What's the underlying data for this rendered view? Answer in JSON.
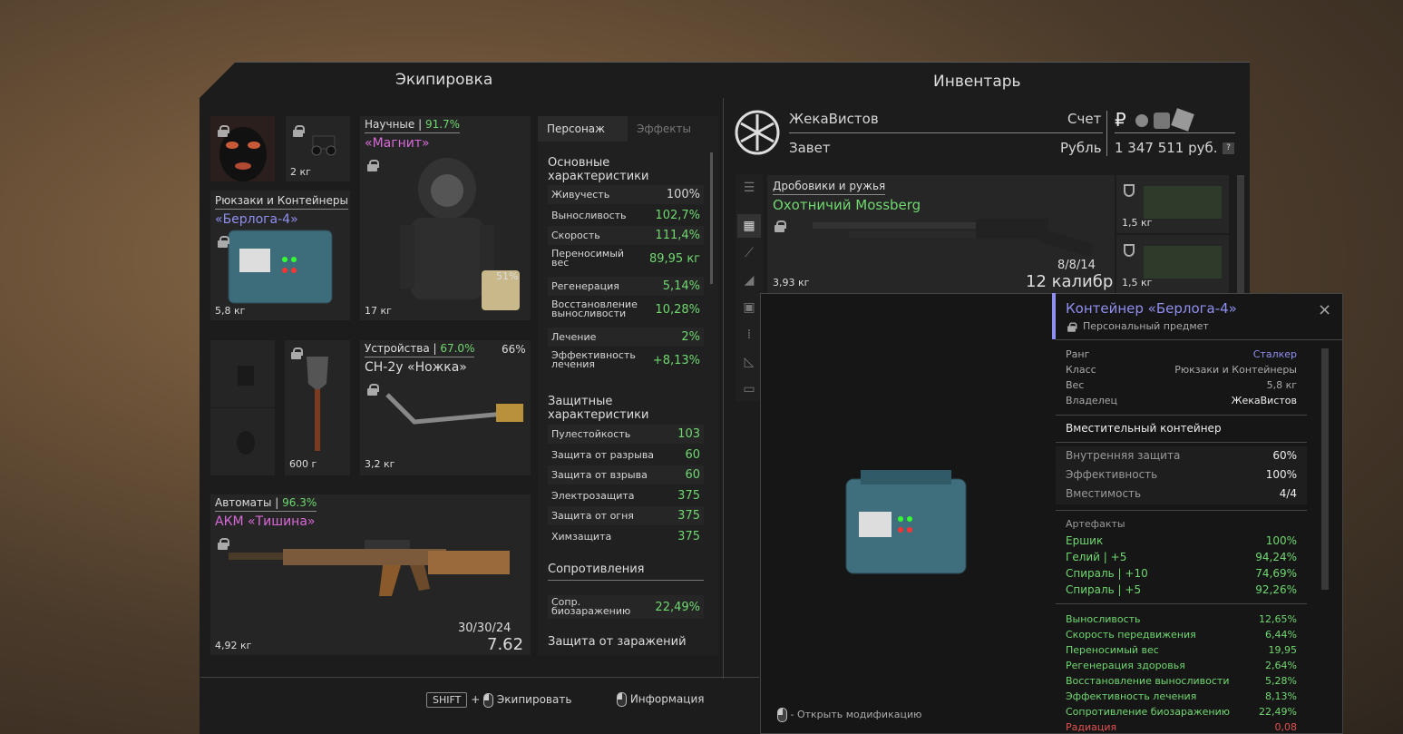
{
  "equipment": {
    "title": "Экипировка",
    "mask": {
      "icon": "mask-icon"
    },
    "nvg": {
      "weight": "2 кг"
    },
    "backpack": {
      "category": "Рюкзаки и Контейнеры",
      "name": "«Берлога-4»",
      "weight": "5,8 кг"
    },
    "armor": {
      "category": "Научные",
      "percent": "91.7%",
      "name": "«Магнит»",
      "weight": "17 кг",
      "battery": "51%"
    },
    "detector": {
      "category": "Устройства",
      "percent": "67.0%",
      "percent2": "66%",
      "name": "СН-2у «Ножка»",
      "weight": "3,2 кг"
    },
    "shovel": {
      "weight": "600 г"
    },
    "rifle": {
      "category": "Автоматы",
      "percent": "96.3%",
      "name": "АКМ «Тишина»",
      "weight": "4,92 кг",
      "ammo": "30/30/24",
      "caliber": "7.62"
    }
  },
  "stats": {
    "tabs": [
      "Персонаж",
      "Эффекты"
    ],
    "main_title": "Основные характеристики",
    "main": [
      {
        "label": "Живучесть",
        "value": "100%"
      },
      {
        "label": "Выносливость",
        "value": "102,7%"
      },
      {
        "label": "Скорость",
        "value": "111,4%"
      },
      {
        "label": "Переносимый вес",
        "value": "89,95 кг"
      },
      {
        "label": "Регенерация",
        "value": "5,14%"
      },
      {
        "label": "Восстановление выносливости",
        "value": "10,28%"
      },
      {
        "label": "Лечение",
        "value": "2%"
      },
      {
        "label": "Эффективность лечения",
        "value": "+8,13%"
      }
    ],
    "def_title": "Защитные характеристики",
    "def": [
      {
        "label": "Пулестойкость",
        "value": "103"
      },
      {
        "label": "Защита от разрыва",
        "value": "60"
      },
      {
        "label": "Защита от взрыва",
        "value": "60"
      },
      {
        "label": "Электрозащита",
        "value": "375"
      },
      {
        "label": "Защита от огня",
        "value": "375"
      },
      {
        "label": "Химзащита",
        "value": "375"
      }
    ],
    "res_title": "Сопротивления",
    "res": [
      {
        "label": "Сопр. биозаражению",
        "value": "22,49%"
      }
    ],
    "inf_title": "Защита от заражений"
  },
  "inventory": {
    "title": "Инвентарь",
    "player": "ЖекаВистов",
    "faction": "Завет",
    "account_label": "Счет",
    "currency_label": "Рубль",
    "currency_symbol": "₽",
    "balance": "1 347 511 руб.",
    "help": "?",
    "shotgun": {
      "category": "Дробовики и ружья",
      "name": "Охотничий Mossberg",
      "weight": "3,93 кг",
      "ammo": "8/8/14",
      "caliber": "12 калибр"
    },
    "case1": {
      "weight": "1,5 кг"
    },
    "case2": {
      "weight": "1,5 кг"
    }
  },
  "tooltip": {
    "title": "Контейнер «Берлога-4»",
    "subtitle": "Персональный предмет",
    "close": "×",
    "info": [
      {
        "label": "Ранг",
        "value": "Сталкер"
      },
      {
        "label": "Класс",
        "value": "Рюкзаки и Контейнеры"
      },
      {
        "label": "Вес",
        "value": "5,8 кг"
      },
      {
        "label": "Владелец",
        "value": "ЖекаВистов"
      }
    ],
    "type": "Вместительный контейнер",
    "props": [
      {
        "label": "Внутренняя защита",
        "value": "60%"
      },
      {
        "label": "Эффективность",
        "value": "100%"
      },
      {
        "label": "Вместимость",
        "value": "4/4"
      }
    ],
    "artifacts_title": "Артефакты",
    "artifacts": [
      {
        "label": "Ершик",
        "value": "100%"
      },
      {
        "label": "Гелий | +5",
        "value": "94,24%"
      },
      {
        "label": "Спираль | +10",
        "value": "74,69%"
      },
      {
        "label": "Спираль | +5",
        "value": "92,26%"
      }
    ],
    "bonuses": [
      {
        "label": "Выносливость",
        "value": "12,65%"
      },
      {
        "label": "Скорость передвижения",
        "value": "6,44%"
      },
      {
        "label": "Переносимый вес",
        "value": "19,95"
      },
      {
        "label": "Регенерация здоровья",
        "value": "2,64%"
      },
      {
        "label": "Восстановление выносливости",
        "value": "5,28%"
      },
      {
        "label": "Эффективность лечения",
        "value": "8,13%"
      },
      {
        "label": "Сопротивление биозаражению",
        "value": "22,49%"
      },
      {
        "label": "Радиация",
        "value": "0,08"
      }
    ],
    "hint": "- Открыть модификацию"
  },
  "footer": {
    "shift": "SHIFT",
    "plus": "+",
    "equip": "Экипировать",
    "info": "Информация"
  },
  "colors": {
    "accent_green": "#6fd86f",
    "accent_pink": "#d86ad8",
    "accent_blue": "#8f8ff0",
    "red": "#e05050"
  }
}
